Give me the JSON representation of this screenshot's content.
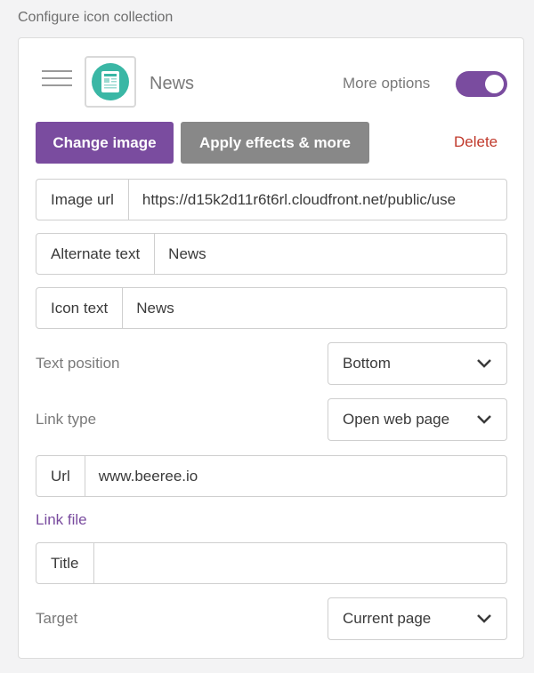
{
  "section_title": "Configure icon collection",
  "item": {
    "name": "News",
    "thumbnail_icon": "newspaper-icon",
    "more_options_label": "More options",
    "more_options_on": true
  },
  "actions": {
    "change_image": "Change image",
    "apply_effects": "Apply effects & more",
    "delete": "Delete"
  },
  "fields": {
    "image_url": {
      "label": "Image url",
      "value": "https://d15k2d11r6t6rl.cloudfront.net/public/use"
    },
    "alternate_text": {
      "label": "Alternate text",
      "value": "News"
    },
    "icon_text": {
      "label": "Icon text",
      "value": "News"
    },
    "url": {
      "label": "Url",
      "value": "www.beeree.io"
    },
    "title": {
      "label": "Title",
      "value": ""
    }
  },
  "selects": {
    "text_position": {
      "label": "Text position",
      "value": "Bottom"
    },
    "link_type": {
      "label": "Link type",
      "value": "Open web page"
    },
    "target": {
      "label": "Target",
      "value": "Current page"
    }
  },
  "link_file": "Link file",
  "colors": {
    "primary": "#7a4c9f",
    "secondary": "#888888",
    "danger": "#c0392b",
    "thumbnail_bg": "#3ab7a5"
  }
}
